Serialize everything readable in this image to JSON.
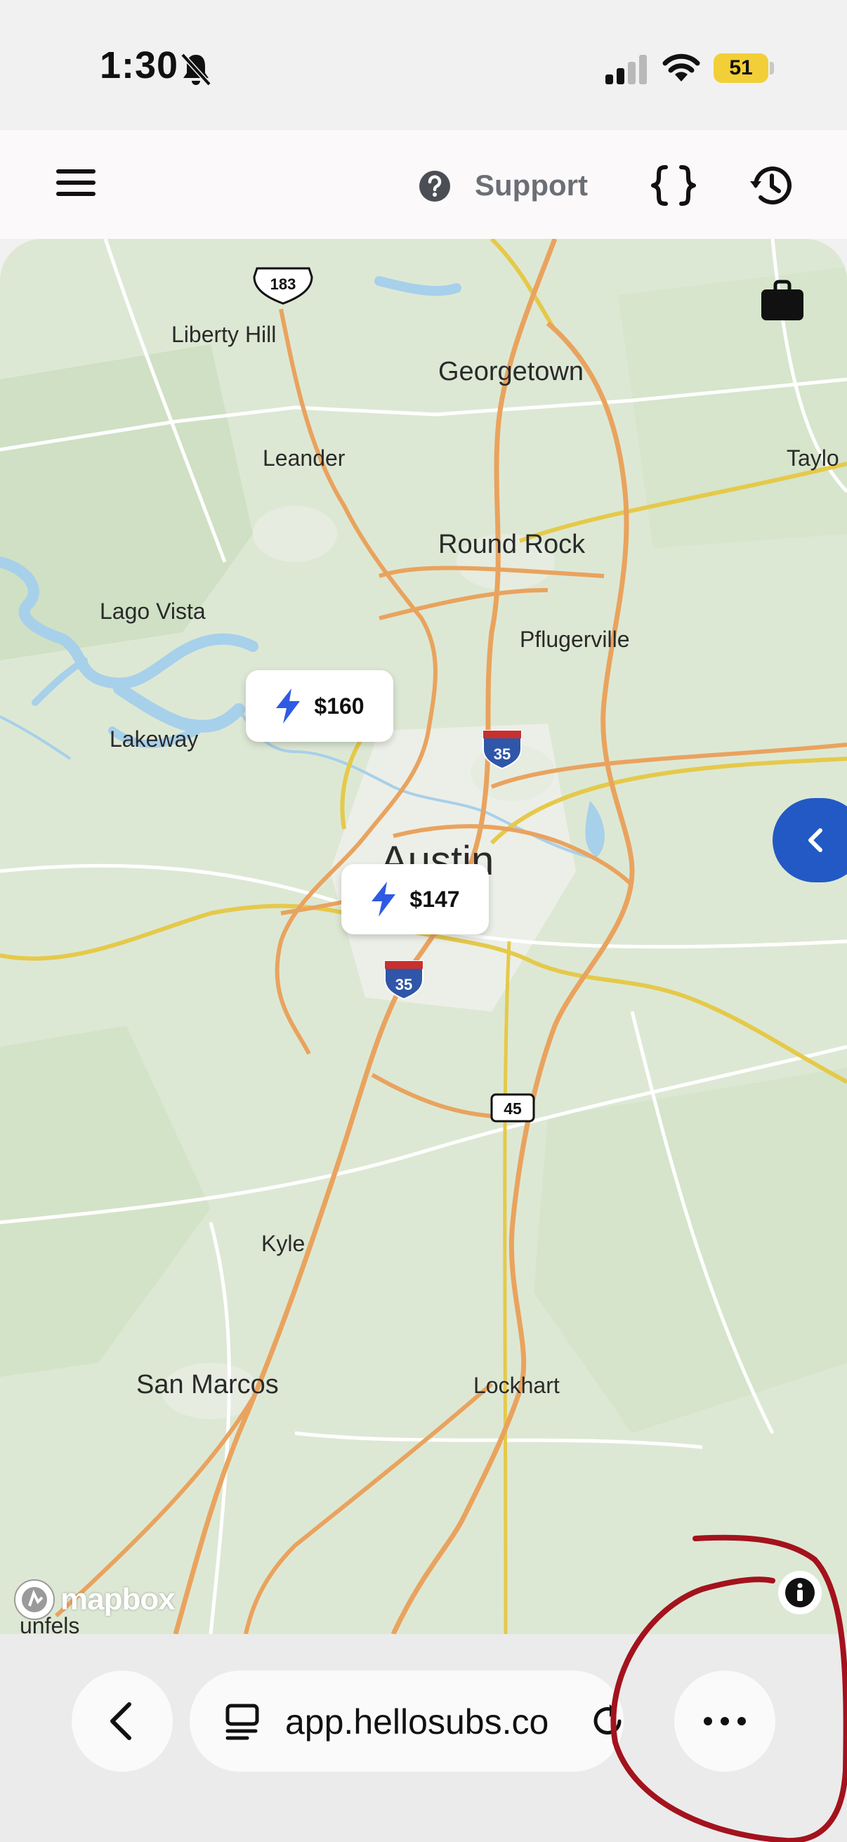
{
  "status_bar": {
    "time": "1:30",
    "battery": "51"
  },
  "header": {
    "support_label": "Support"
  },
  "map": {
    "towns": {
      "liberty_hill": "Liberty Hill",
      "georgetown": "Georgetown",
      "leander": "Leander",
      "taylor": "Taylo",
      "round_rock": "Round Rock",
      "lago_vista": "Lago Vista",
      "pflugerville": "Pflugerville",
      "lakeway": "Lakeway",
      "austin": "Austin",
      "kyle": "Kyle",
      "san_marcos": "San Marcos",
      "lockhart": "Lockhart",
      "new_braunfels": "unfels"
    },
    "shields": {
      "us_183": "183",
      "i35_north": "35",
      "i35_south": "35",
      "sh_45": "45"
    },
    "price_pins": [
      {
        "price": "$160"
      },
      {
        "price": "$147"
      }
    ],
    "attribution": "mapbox",
    "colors": {
      "water": "#a7d0ea",
      "highway": "#e9a35e",
      "state_road": "#e5c94a",
      "toggle": "#2359c4"
    }
  },
  "browser": {
    "url": "app.hellosubs.co"
  },
  "annotation": {
    "color": "#a3121d"
  }
}
